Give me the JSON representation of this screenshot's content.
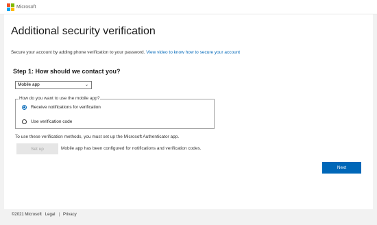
{
  "header": {
    "brand": "Microsoft",
    "logo_colors": [
      "#f25022",
      "#7fba00",
      "#00a4ef",
      "#ffb900"
    ]
  },
  "page": {
    "title": "Additional security verification",
    "intro_text": "Secure your account by adding phone verification to your password.",
    "intro_link": "View video to know how to secure your account",
    "step_heading": "Step 1: How should we contact you?",
    "contact_method": "Mobile app",
    "mobile_app_legend": "How do you want to use the mobile app?",
    "options": [
      {
        "label": "Receive notifications for verification",
        "selected": true
      },
      {
        "label": "Use verification code",
        "selected": false
      }
    ],
    "setup_note": "To use these verification methods, you must set up the Microsoft Authenticator app.",
    "setup_button": "Set up",
    "configured_text": "Mobile app has been configured for notifications and verification codes.",
    "next_button": "Next"
  },
  "footer": {
    "copyright": "©2021 Microsoft",
    "legal": "Legal",
    "separator": "|",
    "privacy": "Privacy"
  },
  "colors": {
    "accent": "#0067b8",
    "background": "#f2f2f2"
  }
}
